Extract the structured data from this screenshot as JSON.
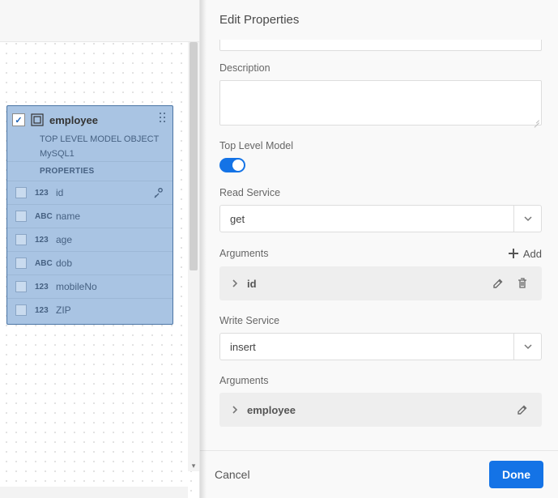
{
  "panel": {
    "title": "Edit Properties",
    "description_label": "Description",
    "description_value": "",
    "top_level_model_label": "Top Level Model",
    "top_level_model_on": true,
    "read_service_label": "Read Service",
    "read_service_value": "get",
    "arguments_label": "Arguments",
    "add_label": "Add",
    "read_args": [
      {
        "name": "id"
      }
    ],
    "write_service_label": "Write Service",
    "write_service_value": "insert",
    "write_args": [
      {
        "name": "employee"
      }
    ],
    "cancel_label": "Cancel",
    "done_label": "Done"
  },
  "model": {
    "checked": true,
    "title": "employee",
    "subtitle1": "TOP LEVEL MODEL OBJECT",
    "subtitle2": "MySQL1",
    "properties_header": "PROPERTIES",
    "properties": [
      {
        "type": "123",
        "name": "id",
        "key": true
      },
      {
        "type": "ABC",
        "name": "name",
        "key": false
      },
      {
        "type": "123",
        "name": "age",
        "key": false
      },
      {
        "type": "ABC",
        "name": "dob",
        "key": false
      },
      {
        "type": "123",
        "name": "mobileNo",
        "key": false
      },
      {
        "type": "123",
        "name": "ZIP",
        "key": false
      }
    ]
  }
}
